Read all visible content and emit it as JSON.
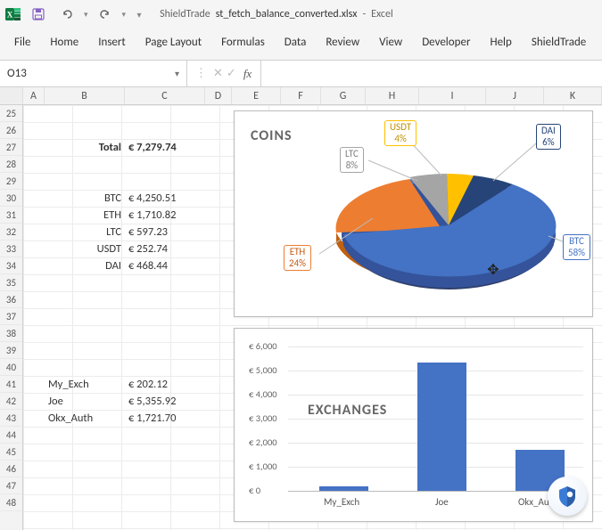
{
  "title": {
    "addin": "ShieldTrade",
    "filename": "st_fetch_balance_converted.xlsx",
    "appname": "Excel"
  },
  "qat": {
    "save": "Save",
    "undo": "Undo",
    "redo": "Redo",
    "customize": "Customize"
  },
  "ribbon": {
    "file": "File",
    "home": "Home",
    "insert": "Insert",
    "page_layout": "Page Layout",
    "formulas": "Formulas",
    "data": "Data",
    "review": "Review",
    "view": "View",
    "developer": "Developer",
    "help": "Help",
    "shieldtrade": "ShieldTrade"
  },
  "namebox": {
    "value": "O13"
  },
  "fx": {
    "cancel": "✕",
    "enter": "✓",
    "fx": "fx"
  },
  "columns": [
    "A",
    "B",
    "C",
    "D",
    "E",
    "F",
    "G",
    "H",
    "I",
    "J",
    "K"
  ],
  "rows_start": 25,
  "rows_end": 48,
  "cells": {
    "total_label": "Total",
    "total_value": "€  7,279.74",
    "btc_label": "BTC",
    "btc_value": "€   4,250.51",
    "eth_label": "ETH",
    "eth_value": "€   1,710.82",
    "ltc_label": "LTC",
    "ltc_value": "€      597.23",
    "usdt_label": "USDT",
    "usdt_value": "€      252.74",
    "dai_label": "DAI",
    "dai_value": "€      468.44",
    "myexch_label": "My_Exch",
    "myexch_value": "€      202.12",
    "joe_label": "Joe",
    "joe_value": "€   5,355.92",
    "okx_label": "Okx_Auth",
    "okx_value": "€   1,721.70"
  },
  "pie": {
    "title": "COINS",
    "labels": {
      "usdt": "USDT\n4%",
      "ltc": "LTC\n8%",
      "eth": "ETH\n24%",
      "dai": "DAI\n6%",
      "btc": "BTC\n58%"
    }
  },
  "bar": {
    "title": "EXCHANGES",
    "ylabels": [
      "€ 6,000",
      "€ 5,000",
      "€ 4,000",
      "€ 3,000",
      "€ 2,000",
      "€ 1,000",
      "€ 0"
    ],
    "categories": [
      "My_Exch",
      "Joe",
      "Okx_Auth"
    ]
  },
  "chart_data": [
    {
      "type": "pie",
      "title": "COINS",
      "categories": [
        "BTC",
        "ETH",
        "LTC",
        "USDT",
        "DAI"
      ],
      "values": [
        4250.51,
        1710.82,
        597.23,
        252.74,
        468.44
      ],
      "percent_labels": {
        "BTC": 58,
        "ETH": 24,
        "LTC": 8,
        "USDT": 4,
        "DAI": 6
      },
      "currency": "EUR"
    },
    {
      "type": "bar",
      "title": "EXCHANGES",
      "categories": [
        "My_Exch",
        "Joe",
        "Okx_Auth"
      ],
      "values": [
        202.12,
        5355.92,
        1721.7
      ],
      "ylabel": "",
      "ylim": [
        0,
        6000
      ],
      "ytick_step": 1000,
      "currency": "EUR"
    }
  ],
  "colors": {
    "blue": "#4472c4",
    "orange": "#ed7d31",
    "gray": "#a5a5a5",
    "yellow": "#ffc000",
    "darkblue": "#264478"
  }
}
